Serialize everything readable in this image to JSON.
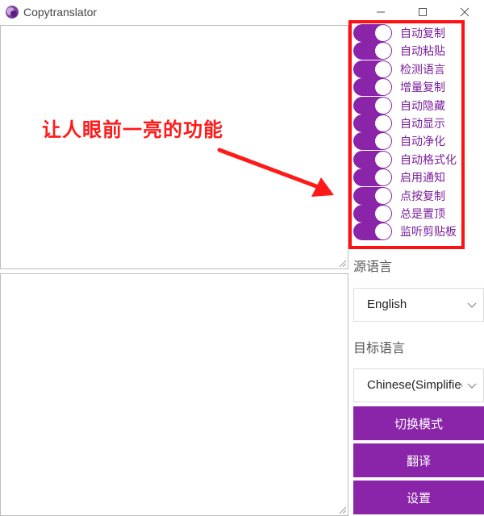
{
  "window": {
    "title": "Copytranslator"
  },
  "annotation": {
    "text": "让人眼前一亮的功能",
    "color": "#ff1a1a"
  },
  "toggles": [
    {
      "label": "自动复制",
      "on": true
    },
    {
      "label": "自动粘贴",
      "on": true
    },
    {
      "label": "检测语言",
      "on": true
    },
    {
      "label": "增量复制",
      "on": true
    },
    {
      "label": "自动隐藏",
      "on": true
    },
    {
      "label": "自动显示",
      "on": true
    },
    {
      "label": "自动净化",
      "on": true
    },
    {
      "label": "自动格式化",
      "on": true
    },
    {
      "label": "启用通知",
      "on": true
    },
    {
      "label": "点按复制",
      "on": true
    },
    {
      "label": "总是置顶",
      "on": true
    },
    {
      "label": "监听剪贴板",
      "on": true
    }
  ],
  "source_lang": {
    "label": "源语言",
    "value": "English"
  },
  "target_lang": {
    "label": "目标语言",
    "value": "Chinese(Simplified)"
  },
  "buttons": {
    "switch_mode": "切换模式",
    "translate": "翻译",
    "settings": "设置"
  },
  "colors": {
    "accent": "#8a24a8",
    "highlight": "#ff1111"
  }
}
